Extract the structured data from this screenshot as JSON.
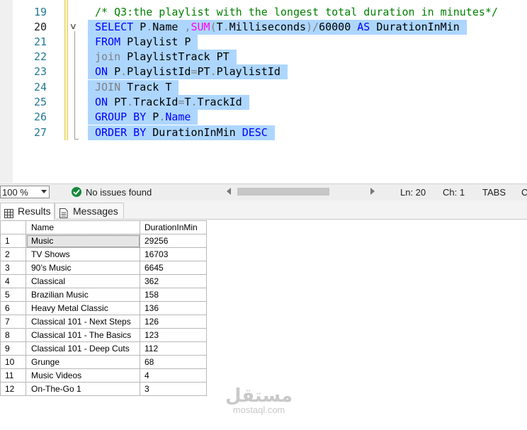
{
  "editor": {
    "lines": [
      {
        "num": "19",
        "comment": "/* Q3:the playlist with the longest total duration in minutes*/"
      },
      {
        "num": "20",
        "tokens": [
          {
            "c": "k",
            "t": "SELECT "
          },
          {
            "c": "t",
            "t": "P"
          },
          {
            "c": "g",
            "t": "."
          },
          {
            "c": "t",
            "t": "Name "
          },
          {
            "c": "g",
            "t": ","
          },
          {
            "c": "f",
            "t": "SUM"
          },
          {
            "c": "g",
            "t": "("
          },
          {
            "c": "t",
            "t": "T"
          },
          {
            "c": "g",
            "t": "."
          },
          {
            "c": "t",
            "t": "Milliseconds"
          },
          {
            "c": "g",
            "t": ")/"
          },
          {
            "c": "t",
            "t": "60000 "
          },
          {
            "c": "k",
            "t": "AS "
          },
          {
            "c": "t",
            "t": "DurationInMin"
          }
        ]
      },
      {
        "num": "21",
        "tokens": [
          {
            "c": "k",
            "t": "FROM "
          },
          {
            "c": "t",
            "t": "Playlist P"
          }
        ]
      },
      {
        "num": "22",
        "tokens": [
          {
            "c": "g",
            "t": "join "
          },
          {
            "c": "t",
            "t": "PlaylistTrack PT"
          }
        ]
      },
      {
        "num": "23",
        "tokens": [
          {
            "c": "k",
            "t": "ON "
          },
          {
            "c": "t",
            "t": "P"
          },
          {
            "c": "g",
            "t": "."
          },
          {
            "c": "t",
            "t": "PlaylistId"
          },
          {
            "c": "g",
            "t": "="
          },
          {
            "c": "t",
            "t": "PT"
          },
          {
            "c": "g",
            "t": "."
          },
          {
            "c": "t",
            "t": "PlaylistId"
          }
        ]
      },
      {
        "num": "24",
        "tokens": [
          {
            "c": "g",
            "t": "JOIN "
          },
          {
            "c": "t",
            "t": "Track T"
          }
        ]
      },
      {
        "num": "25",
        "tokens": [
          {
            "c": "k",
            "t": "ON "
          },
          {
            "c": "t",
            "t": "PT"
          },
          {
            "c": "g",
            "t": "."
          },
          {
            "c": "t",
            "t": "TrackId"
          },
          {
            "c": "g",
            "t": "="
          },
          {
            "c": "t",
            "t": "T"
          },
          {
            "c": "g",
            "t": "."
          },
          {
            "c": "t",
            "t": "TrackId"
          }
        ]
      },
      {
        "num": "26",
        "tokens": [
          {
            "c": "k",
            "t": "GROUP BY "
          },
          {
            "c": "t",
            "t": "P"
          },
          {
            "c": "g",
            "t": "."
          },
          {
            "c": "k",
            "t": "Name"
          }
        ]
      },
      {
        "num": "27",
        "tokens": [
          {
            "c": "k",
            "t": "ORDER BY "
          },
          {
            "c": "t",
            "t": "DurationInMin "
          },
          {
            "c": "k",
            "t": "DESC"
          }
        ]
      }
    ]
  },
  "status": {
    "zoom": "100 %",
    "issues": "No issues found",
    "line": "Ln: 20",
    "col": "Ch: 1",
    "tabs": "TABS",
    "trailing": "C"
  },
  "tabs": {
    "results": "Results",
    "messages": "Messages"
  },
  "grid": {
    "columns": [
      "Name",
      "DurationInMin"
    ],
    "rows": [
      [
        "1",
        "Music",
        "29256"
      ],
      [
        "2",
        "TV Shows",
        "16703"
      ],
      [
        "3",
        "90’s Music",
        "6645"
      ],
      [
        "4",
        "Classical",
        "362"
      ],
      [
        "5",
        "Brazilian Music",
        "158"
      ],
      [
        "6",
        "Heavy Metal Classic",
        "136"
      ],
      [
        "7",
        "Classical 101 - Next Steps",
        "126"
      ],
      [
        "8",
        "Classical 101 - The Basics",
        "123"
      ],
      [
        "9",
        "Classical 101 - Deep Cuts",
        "112"
      ],
      [
        "10",
        "Grunge",
        "68"
      ],
      [
        "11",
        "Music Videos",
        "4"
      ],
      [
        "12",
        "On-The-Go 1",
        "3"
      ]
    ]
  },
  "watermark": {
    "arabic": "مستقل",
    "latin": "mostaql.com"
  }
}
